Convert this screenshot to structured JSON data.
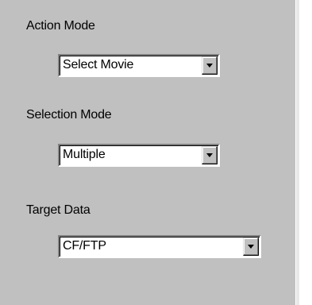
{
  "fields": [
    {
      "label": "Action Mode",
      "value": "Select Movie"
    },
    {
      "label": "Selection Mode",
      "value": "Multiple"
    },
    {
      "label": "Target Data",
      "value": "CF/FTP"
    }
  ],
  "icons": {
    "dropdown": "chevron-down-icon"
  },
  "colors": {
    "panel": "#c0c0c0",
    "field": "#ffffff",
    "text": "#000000"
  }
}
